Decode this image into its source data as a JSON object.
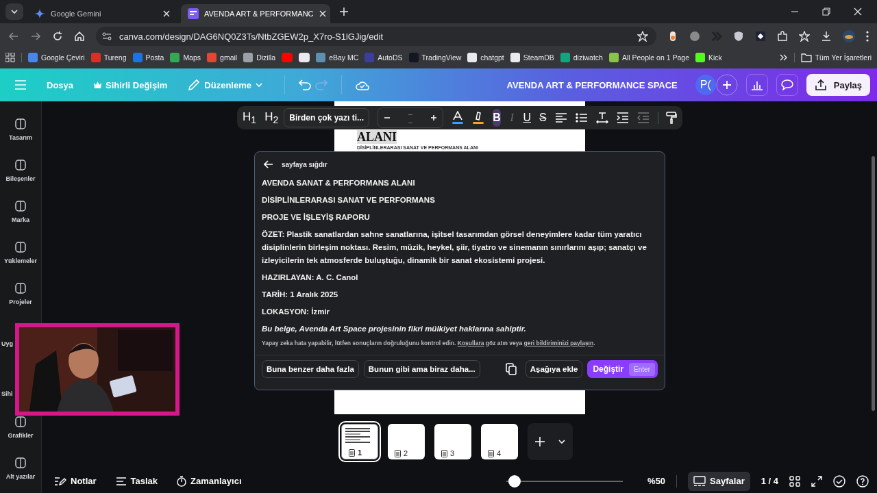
{
  "browser": {
    "tabs": [
      {
        "title": "Google Gemini",
        "selected": false
      },
      {
        "title": "AVENDA ART & PERFORMANC",
        "selected": true
      }
    ],
    "url": "canva.com/design/DAG6NQ0Z3Ts/NtbZGEW2p_X7ro-S1lGJig/edit",
    "bookmarks": [
      {
        "label": "Google Çeviri",
        "color": "#4a86e8"
      },
      {
        "label": "Tureng",
        "color": "#d93025"
      },
      {
        "label": "Posta",
        "color": "#1a73e8"
      },
      {
        "label": "Maps",
        "color": "#34a853"
      },
      {
        "label": "gmail",
        "color": "#ea4335"
      },
      {
        "label": "Dizilla",
        "color": "#9aa0a6"
      },
      {
        "color": "#ff0000"
      },
      {
        "color": "#e8eaed"
      },
      {
        "label": "eBay MC",
        "color": "#5f8fb0"
      },
      {
        "label": "AutoDS",
        "color": "#3b3f9a"
      },
      {
        "label": "TradingView",
        "color": "#131722"
      },
      {
        "label": "chatgpt",
        "color": "#e8eaed"
      },
      {
        "label": "SteamDB",
        "color": "#e8eaed"
      },
      {
        "label": "diziwatch",
        "color": "#14a37f"
      },
      {
        "label": "All People on 1 Page",
        "color": "#8bc34a"
      },
      {
        "label": "Kick",
        "color": "#53fc18"
      }
    ],
    "all_bookmarks": "Tüm Yer İşaretleri"
  },
  "header": {
    "menu": [
      {
        "label": "Dosya",
        "kind": "plain"
      },
      {
        "label": "Sihirli Değişim",
        "kind": "crown"
      },
      {
        "label": "Düzenleme",
        "kind": "dropdown"
      }
    ],
    "title": "AVENDA ART & PERFORMANCE SPACE",
    "avatar": "P(",
    "share": "Paylaş"
  },
  "sidebar": [
    {
      "label": "Tasarım",
      "kind": "full"
    },
    {
      "label": "Bileşenler",
      "kind": "full"
    },
    {
      "label": "Marka",
      "kind": "full"
    },
    {
      "label": "Yüklemeler",
      "kind": "full"
    },
    {
      "label": "Projeler",
      "kind": "full"
    },
    {
      "label": "Uyg",
      "kind": "partial"
    },
    {
      "label": "Sihi",
      "kind": "partial"
    },
    {
      "label": "Grafikler",
      "kind": "full"
    },
    {
      "label": "Alt yazılar",
      "kind": "full"
    }
  ],
  "toolbar": {
    "headings": [
      "H$_{1}$",
      "H$_{2}$"
    ],
    "font": "Birden çok yazı ti...",
    "size": "– –",
    "styles": [
      {
        "kind": "bold",
        "label": "B",
        "selected": true,
        "disabled": false
      },
      {
        "kind": "italic",
        "label": "I",
        "selected": false,
        "disabled": true
      },
      {
        "kind": "underline",
        "label": "U",
        "selected": false,
        "disabled": false
      },
      {
        "kind": "strike",
        "label": "S",
        "selected": false,
        "disabled": false
      }
    ]
  },
  "page": {
    "heading": "ALANI",
    "subtitle": "DİSİPLİNLERARASI SANAT VE PERFORMANS ALANI"
  },
  "popup": {
    "back": "sayfaya sığdır",
    "paragraphs": [
      {
        "text": "AVENDA SANAT & PERFORMANS ALANI",
        "kind": "plain"
      },
      {
        "text": "DİSİPLİNLERARASI SANAT VE PERFORMANS",
        "kind": "plain"
      },
      {
        "text": "PROJE VE İŞLEYİŞ RAPORU",
        "kind": "plain"
      },
      {
        "text": "ÖZET: Plastik sanatlardan sahne sanatlarına, işitsel tasarımdan görsel deneyimlere kadar tüm yaratıcı disiplinlerin birleşim noktası. Resim, müzik, heykel, şiir, tiyatro ve sinemanın sınırlarını aşıp; sanatçı ve izleyicilerin tek atmosferde buluştuğu, dinamik bir sanat ekosistemi projesi.",
        "kind": "plain"
      },
      {
        "text": "HAZIRLAYAN: A. C. Canol",
        "kind": "plain"
      },
      {
        "text": "TARİH: 1 Aralık 2025",
        "kind": "plain"
      },
      {
        "text": "LOKASYON: İzmir",
        "kind": "plain"
      },
      {
        "text": "Bu belge, Avenda Art Space projesinin fikri mülkiyet haklarına sahiptir.",
        "kind": "italic"
      }
    ],
    "disclaimer": {
      "before": "Yapay zeka hata yapabilir, lütfen sonuçların doğruluğunu kontrol edin.",
      "terms_link": "Koşullara",
      "middle": "göz atın veya",
      "feedback_link": "geri bildiriminizi paylaşın",
      "after": "."
    },
    "actions": [
      "Buna benzer daha fazla",
      "Bunun gibi ama biraz daha..."
    ],
    "insert": "Aşağıya ekle",
    "replace": "Değiştir",
    "replace_key": "Enter"
  },
  "pages": [
    {
      "number": "1",
      "selected": true
    },
    {
      "number": "2",
      "selected": false
    },
    {
      "number": "3",
      "selected": false
    },
    {
      "number": "4",
      "selected": false
    }
  ],
  "bottom": {
    "notes": "Notlar",
    "outline": "Taslak",
    "timer": "Zamanlayıcı",
    "zoom": {
      "level": 0.02
    },
    "zoom_label": "%50",
    "pages_button": "Sayfalar",
    "page_count": "1 / 4"
  }
}
